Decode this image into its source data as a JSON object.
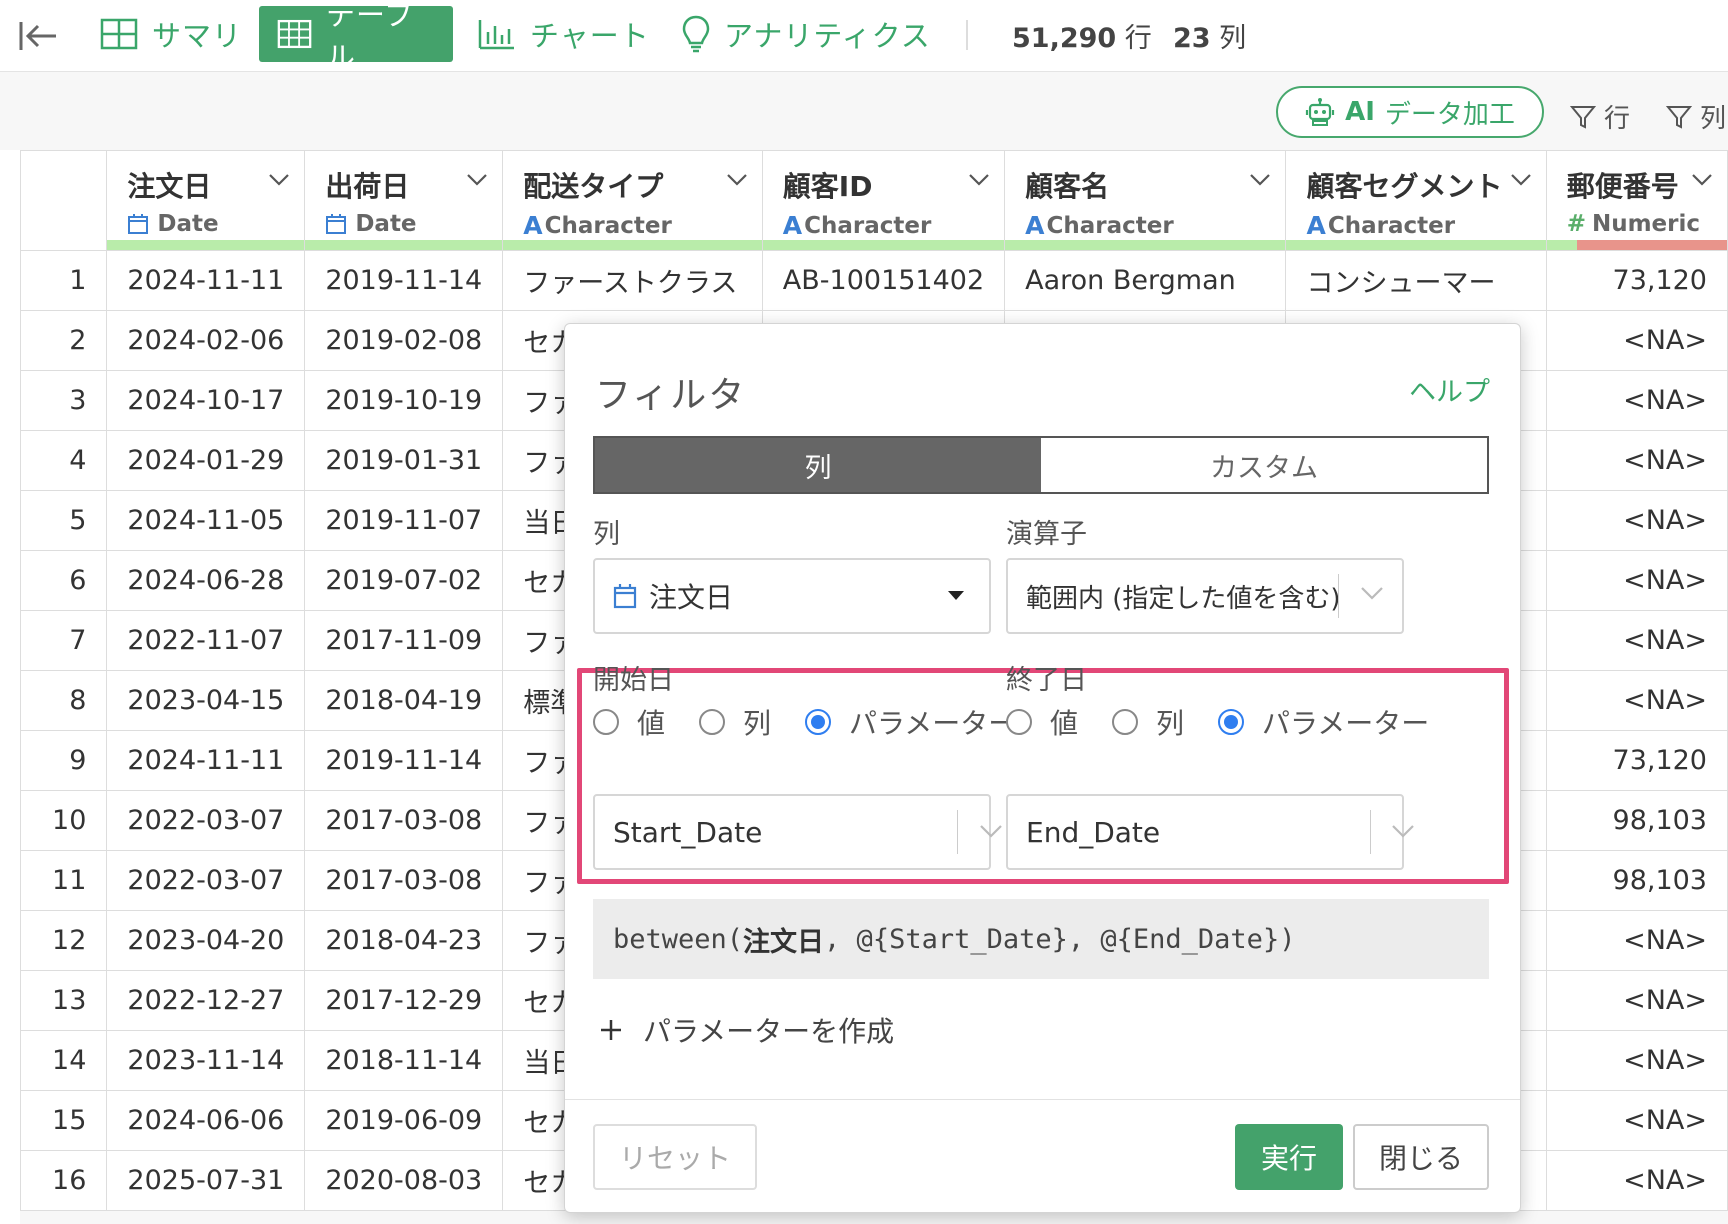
{
  "tabs": [
    {
      "label": "サマリ",
      "active": false
    },
    {
      "label": "テーブル",
      "active": true
    },
    {
      "label": "チャート",
      "active": false
    },
    {
      "label": "アナリティクス",
      "active": false
    }
  ],
  "stats": {
    "rows_value": "51,290",
    "rows_unit": "行",
    "cols_value": "23",
    "cols_unit": "列"
  },
  "toolbar": {
    "ai_bold": "AI",
    "ai_label": "データ加工",
    "row_filter": "行",
    "col_filter": "列"
  },
  "columns": [
    {
      "name": "注文日",
      "type": "Date"
    },
    {
      "name": "出荷日",
      "type": "Date"
    },
    {
      "name": "配送タイプ",
      "type": "Character"
    },
    {
      "name": "顧客ID",
      "type": "Character"
    },
    {
      "name": "顧客名",
      "type": "Character"
    },
    {
      "name": "顧客セグメント",
      "type": "Character"
    },
    {
      "name": "郵便番号",
      "type": "Numeric"
    }
  ],
  "rows": [
    {
      "n": "1",
      "order": "2024-11-11",
      "ship": "2019-11-14",
      "type": "ファーストクラス",
      "cid": "AB-100151402",
      "cname": "Aaron Bergman",
      "seg": "コンシューマー",
      "zip": "73,120"
    },
    {
      "n": "2",
      "order": "2024-02-06",
      "ship": "2019-02-08",
      "type": "セカ",
      "cid": "",
      "cname": "",
      "seg": "",
      "zip": "<NA>"
    },
    {
      "n": "3",
      "order": "2024-10-17",
      "ship": "2019-10-19",
      "type": "ファ",
      "cid": "",
      "cname": "",
      "seg": "",
      "zip": "<NA>"
    },
    {
      "n": "4",
      "order": "2024-01-29",
      "ship": "2019-01-31",
      "type": "ファ",
      "cid": "",
      "cname": "",
      "seg": "",
      "zip": "<NA>"
    },
    {
      "n": "5",
      "order": "2024-11-05",
      "ship": "2019-11-07",
      "type": "当日",
      "cid": "",
      "cname": "",
      "seg": "",
      "zip": "<NA>"
    },
    {
      "n": "6",
      "order": "2024-06-28",
      "ship": "2019-07-02",
      "type": "セカ",
      "cid": "",
      "cname": "",
      "seg": "",
      "zip": "<NA>"
    },
    {
      "n": "7",
      "order": "2022-11-07",
      "ship": "2017-11-09",
      "type": "ファ",
      "cid": "",
      "cname": "",
      "seg": "",
      "zip": "<NA>"
    },
    {
      "n": "8",
      "order": "2023-04-15",
      "ship": "2018-04-19",
      "type": "標準",
      "cid": "",
      "cname": "",
      "seg": "",
      "zip": "<NA>"
    },
    {
      "n": "9",
      "order": "2024-11-11",
      "ship": "2019-11-14",
      "type": "ファ",
      "cid": "",
      "cname": "",
      "seg": "",
      "zip": "73,120"
    },
    {
      "n": "10",
      "order": "2022-03-07",
      "ship": "2017-03-08",
      "type": "ファ",
      "cid": "",
      "cname": "",
      "seg": "",
      "zip": "98,103"
    },
    {
      "n": "11",
      "order": "2022-03-07",
      "ship": "2017-03-08",
      "type": "ファ",
      "cid": "",
      "cname": "",
      "seg": "",
      "zip": "98,103"
    },
    {
      "n": "12",
      "order": "2023-04-20",
      "ship": "2018-04-23",
      "type": "ファ",
      "cid": "",
      "cname": "",
      "seg": "",
      "zip": "<NA>"
    },
    {
      "n": "13",
      "order": "2022-12-27",
      "ship": "2017-12-29",
      "type": "セカ",
      "cid": "",
      "cname": "",
      "seg": "",
      "zip": "<NA>"
    },
    {
      "n": "14",
      "order": "2023-11-14",
      "ship": "2018-11-14",
      "type": "当日",
      "cid": "",
      "cname": "",
      "seg": "",
      "zip": "<NA>"
    },
    {
      "n": "15",
      "order": "2024-06-06",
      "ship": "2019-06-09",
      "type": "セカ",
      "cid": "",
      "cname": "",
      "seg": "",
      "zip": "<NA>"
    },
    {
      "n": "16",
      "order": "2025-07-31",
      "ship": "2020-08-03",
      "type": "セカ",
      "cid": "",
      "cname": "",
      "seg": "",
      "zip": "<NA>"
    }
  ],
  "dialog": {
    "title": "フィルタ",
    "help": "ヘルプ",
    "seg_column": "列",
    "seg_custom": "カスタム",
    "column_label": "列",
    "column_value": "注文日",
    "operator_label": "演算子",
    "operator_value": "範囲内 (指定した値を含む)",
    "start_label": "開始日",
    "end_label": "終了日",
    "radio_value": "値",
    "radio_column": "列",
    "radio_param": "パラメーター",
    "start_value": "Start_Date",
    "end_value": "End_Date",
    "expr_pre": "between(",
    "expr_col": "注文日",
    "expr_post": ", @{Start_Date}, @{End_Date})",
    "create_param": "パラメーターを作成",
    "reset": "リセット",
    "run": "実行",
    "close": "閉じる"
  },
  "colors": {
    "accent": "#44a26b",
    "highlight": "#e24777",
    "radio": "#2f7ef0"
  }
}
